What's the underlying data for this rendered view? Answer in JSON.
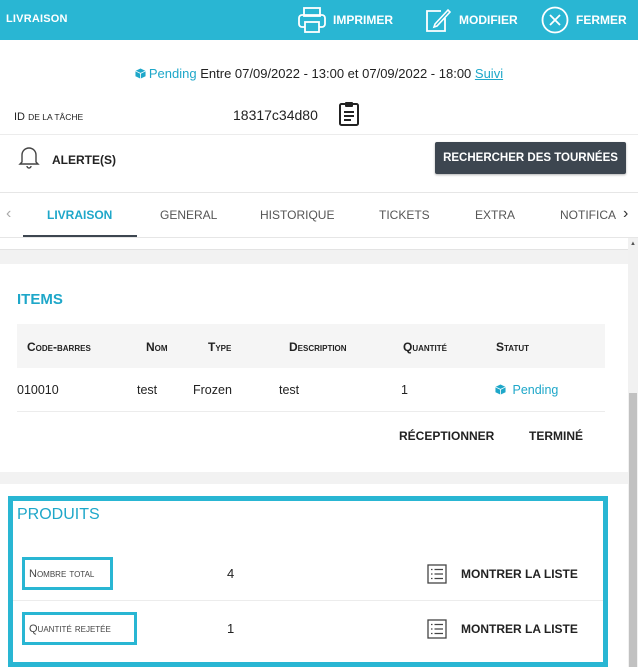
{
  "topbar": {
    "title": "LIVRAISON",
    "print_label": "IMPRIMER",
    "edit_label": "MODIFIER",
    "close_label": "FERMER",
    "color": "#29b6d3"
  },
  "header": {
    "status": "Pending",
    "window_text": "Entre 07/09/2022 - 13:00 et 07/09/2022 - 18:00",
    "track_link": "Suivi",
    "task_id_label_main": "ID",
    "task_id_label_small": "DE LA TÂCHE",
    "task_id_value": "18317c34d80",
    "alerts_label": "ALERTE(S)",
    "search_tours_label": "RECHERCHER DES TOURNÉES"
  },
  "tabs": [
    {
      "label": "LIVRAISON"
    },
    {
      "label": "GENERAL"
    },
    {
      "label": "HISTORIQUE"
    },
    {
      "label": "TICKETS"
    },
    {
      "label": "EXTRA"
    },
    {
      "label": "NOTIFICA"
    }
  ],
  "items": {
    "title": "ITEMS",
    "columns": [
      "Code-barres",
      "Nom",
      "Type",
      "Description",
      "Quantité",
      "Statut"
    ],
    "rows": [
      {
        "barcode": "010010",
        "name": "test",
        "type": "Frozen",
        "description": "test",
        "quantity": "1",
        "status": "Pending"
      }
    ],
    "receive_label": "RÉCEPTIONNER",
    "done_label": "TERMINÉ"
  },
  "produits": {
    "title": "PRODUITS",
    "rows": [
      {
        "label": "Nombre total",
        "value": "4",
        "action": "MONTRER LA LISTE"
      },
      {
        "label": "Quantité rejetée",
        "value": "1",
        "action": "MONTRER LA LISTE"
      }
    ]
  },
  "colors": {
    "accent": "#29b6d3",
    "link": "#1ea7c9",
    "dark_button": "#3d4650"
  }
}
